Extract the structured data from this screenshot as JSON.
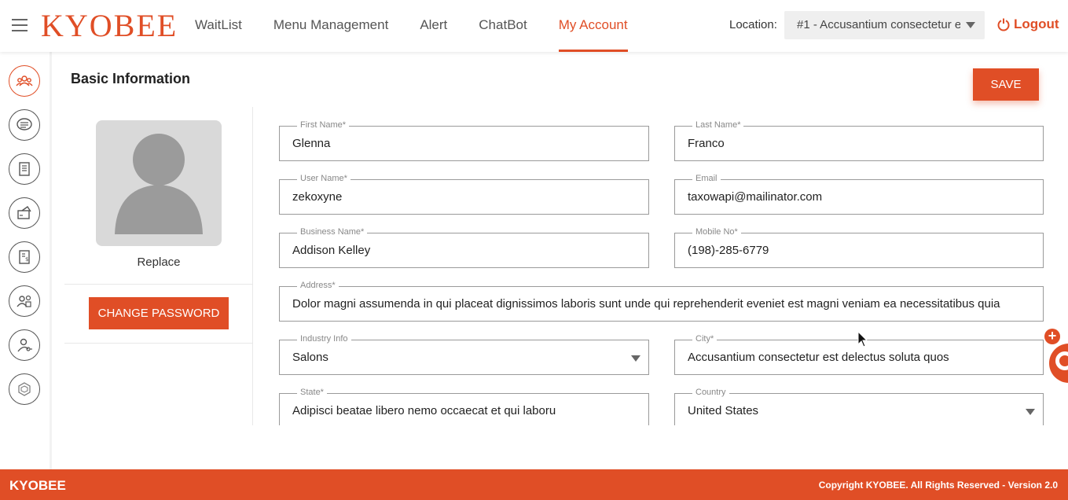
{
  "header": {
    "logo": "KYOBEE",
    "nav": [
      {
        "label": "WaitList"
      },
      {
        "label": "Menu Management"
      },
      {
        "label": "Alert"
      },
      {
        "label": "ChatBot"
      },
      {
        "label": "My Account",
        "active": true
      }
    ],
    "location_label": "Location:",
    "location_value": "#1 - Accusantium consectetur e",
    "logout_label": "Logout"
  },
  "sidebar": {
    "icons": [
      "users-group-icon",
      "chat-icon",
      "menu-document-icon",
      "payment-card-icon",
      "invoice-icon",
      "team-settings-icon",
      "user-key-icon",
      "hexagon-icon"
    ]
  },
  "main": {
    "title": "Basic Information",
    "save_label": "SAVE",
    "profile": {
      "replace_label": "Replace",
      "change_password_label": "CHANGE PASSWORD"
    },
    "fields": {
      "first_name": {
        "label": "First Name*",
        "value": "Glenna"
      },
      "last_name": {
        "label": "Last Name*",
        "value": "Franco"
      },
      "user_name": {
        "label": "User Name*",
        "value": "zekoxyne"
      },
      "email": {
        "label": "Email",
        "value": "taxowapi@mailinator.com"
      },
      "business_name": {
        "label": "Business Name*",
        "value": "Addison Kelley"
      },
      "mobile_no": {
        "label": "Mobile No*",
        "value": "(198)-285-6779"
      },
      "address": {
        "label": "Address*",
        "value": "Dolor magni assumenda in qui placeat dignissimos laboris sunt unde qui reprehenderit eveniet est magni veniam ea necessitatibus quia"
      },
      "industry_info": {
        "label": "Industry Info",
        "value": "Salons"
      },
      "city": {
        "label": "City*",
        "value": "Accusantium consectetur est delectus soluta quos"
      },
      "state": {
        "label": "State*",
        "value": "Adipisci beatae libero nemo occaecat et qui laboru"
      },
      "country": {
        "label": "Country",
        "value": "United States"
      }
    }
  },
  "footer": {
    "brand": "KYOBEE",
    "copyright": "Copyright KYOBEE. All Rights Reserved - Version 2.0"
  },
  "colors": {
    "accent": "#e04e26",
    "border": "#9a9a9a",
    "placeholder_bg": "#d9d9d9"
  }
}
